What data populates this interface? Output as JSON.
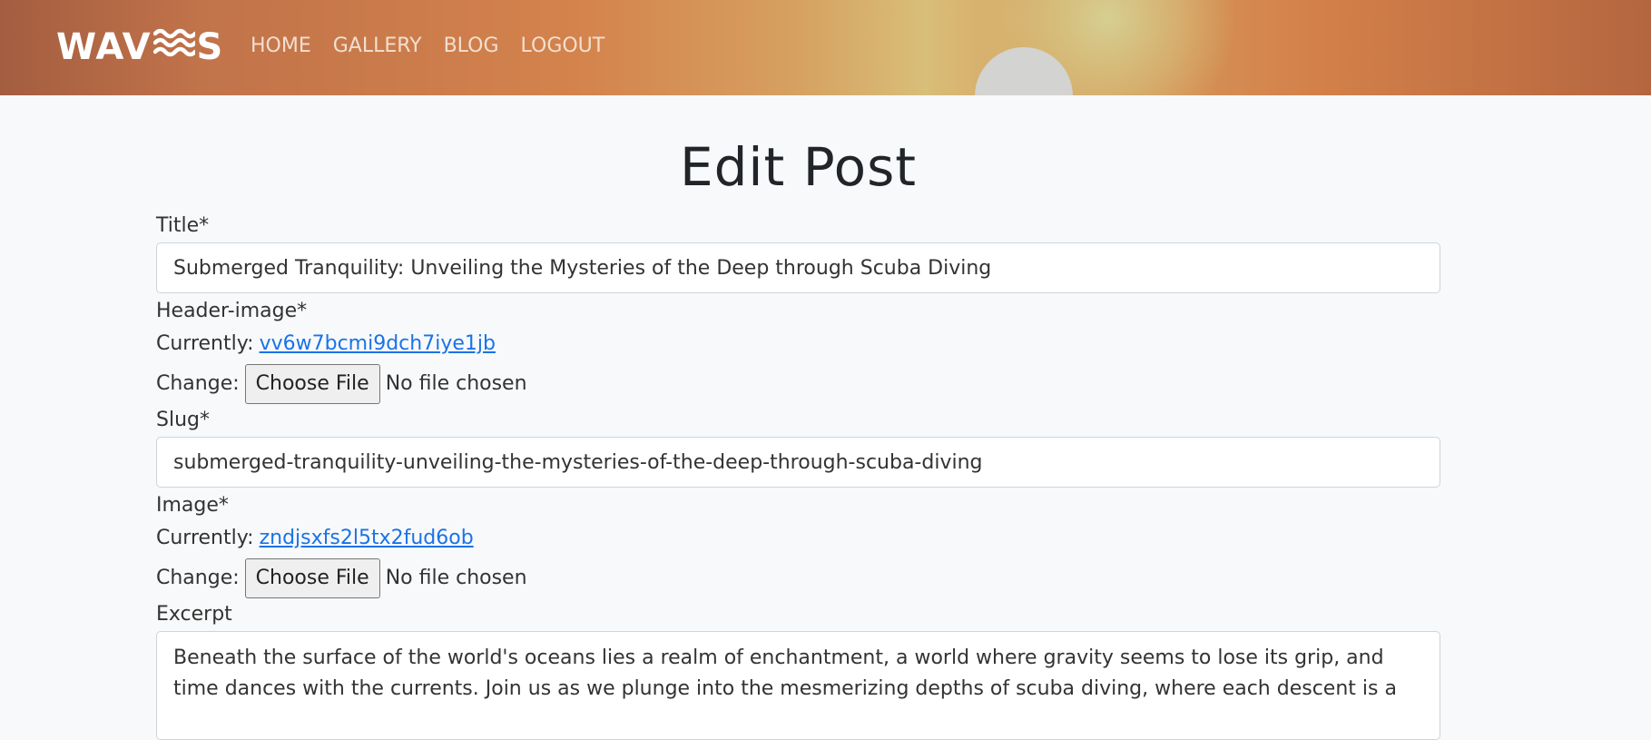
{
  "header": {
    "logo_text": "WAV",
    "logo_tail": "S",
    "logo_icon": "waves-icon",
    "nav": [
      "HOME",
      "GALLERY",
      "BLOG",
      "LOGOUT"
    ],
    "colors": {
      "gradient_start": "#a35d40",
      "gradient_glow": "#d8be78",
      "sun": "#d3d3d1"
    }
  },
  "page": {
    "title": "Edit Post"
  },
  "form": {
    "title_label": "Title*",
    "title_value": "Submerged Tranquility: Unveiling the Mysteries of the Deep through Scuba Diving",
    "header_image_label": "Header-image*",
    "currently_label": "Currently:",
    "header_image_current": "vv6w7bcmi9dch7iye1jb",
    "change_label": "Change:",
    "choose_file_label": "Choose File",
    "no_file_text": "No file chosen",
    "slug_label": "Slug*",
    "slug_value": "submerged-tranquility-unveiling-the-mysteries-of-the-deep-through-scuba-diving",
    "image_label": "Image*",
    "image_current": "zndjsxfs2l5tx2fud6ob",
    "excerpt_label": "Excerpt",
    "excerpt_value": "Beneath the surface of the world's oceans lies a realm of enchantment, a world where gravity seems to lose its grip, and time dances with the currents. Join us as we plunge into the mesmerizing depths of scuba diving, where each descent is a"
  },
  "colors": {
    "link": "#1a73e8",
    "page_bg": "#f8f9fa",
    "text": "#212529"
  }
}
